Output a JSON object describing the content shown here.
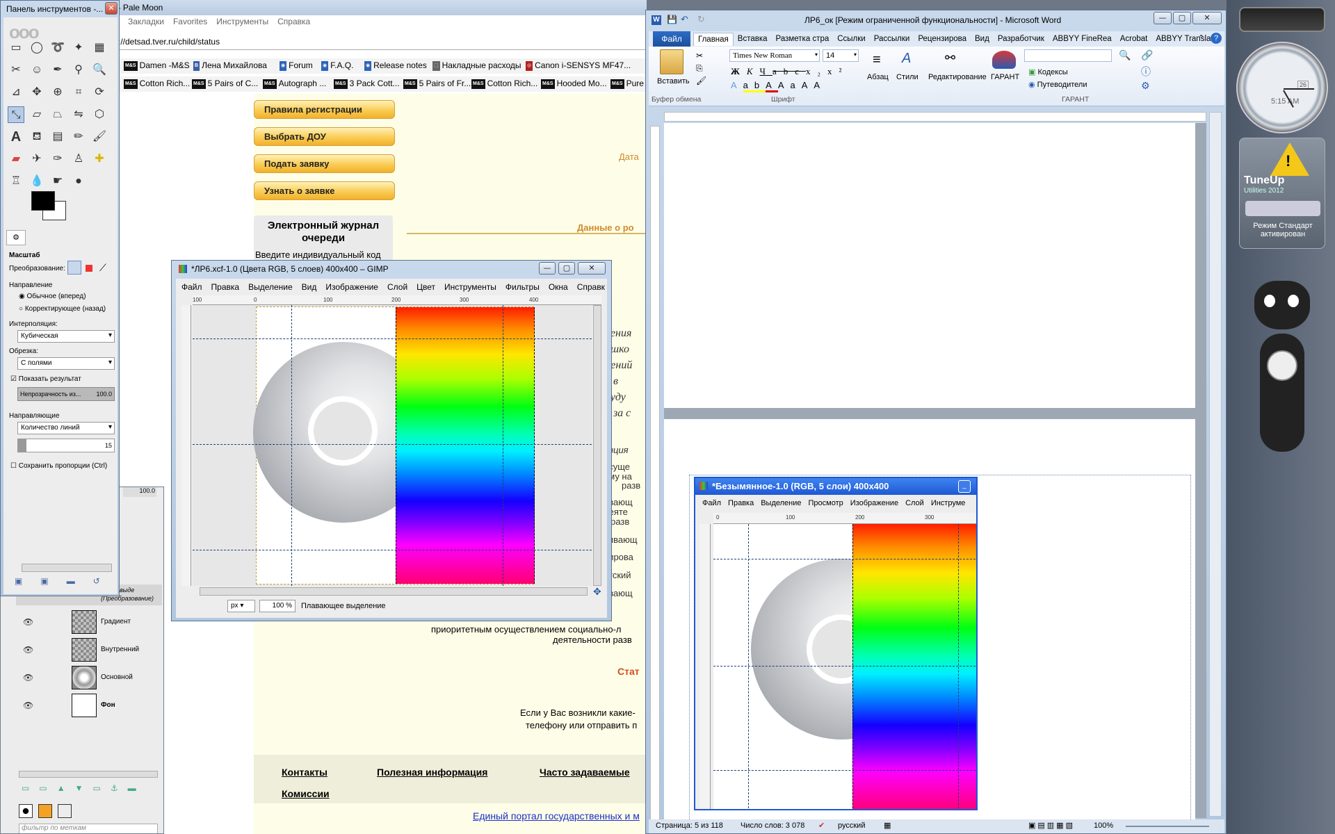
{
  "browser": {
    "title": "ь - Pale Moon",
    "menu": [
      "Закладки",
      "Favorites",
      "Инструменты",
      "Справка"
    ],
    "url": "://detsad.tver.ru/child/status",
    "bm1": [
      {
        "t": "Damen -M&S",
        "b": "M&S"
      },
      {
        "t": "Лена Михайлова",
        "b": "B"
      },
      {
        "t": "Forum",
        "b": "◉"
      },
      {
        "t": "F.A.Q.",
        "b": "◉"
      },
      {
        "t": "Release notes",
        "b": "◉"
      },
      {
        "t": "Накладные расходы",
        "b": "⬚"
      },
      {
        "t": "Canon i-SENSYS MF47...",
        "b": "◎"
      }
    ],
    "bm2": [
      "Cotton Rich...",
      "5 Pairs of C...",
      "Autograph ...",
      "3 Pack Cott...",
      "5 Pairs of Fr...",
      "Cotton Rich...",
      "Hooded Mo...",
      "Pure"
    ],
    "bm_badge": "M&S"
  },
  "site": {
    "buttons": [
      "Правила регистрации",
      "Выбрать ДОУ",
      "Подать заявку",
      "Узнать о заявке"
    ],
    "journal_title": "Электронный журнал очереди",
    "journal_text": "Введите индивидуальный код",
    "date": "Дата",
    "parents": "Данные о ро",
    "frag": [
      "нения",
      "ошко",
      "дений",
      "а в",
      "буду",
      "н за с",
      "виция",
      "осуще",
      "ому на",
      "разв",
      "ивающ",
      "деяте",
      "у разв",
      "вивающ",
      "нирова",
      "ятский",
      "ивающ"
    ],
    "line_a": "приоритетным осуществлением социально-л",
    "line_b": "деятельности разв",
    "status": "Стат",
    "help_a": "Если у Вас возникли какие-",
    "help_b": "телефону или отправить п",
    "footer": [
      "Контакты",
      "Полезная информация",
      "Часто задаваемые",
      "Комиссии"
    ],
    "portal": "Единый портал государственных и м"
  },
  "toolbox": {
    "title": "Панель инструментов -...",
    "section": "Масштаб",
    "transform": "Преобразование:",
    "direction": "Направление",
    "dir_fwd": "Обычное (вперед)",
    "dir_back": "Корректирующее (назад)",
    "interp_l": "Интерполяция:",
    "interp": "Кубическая",
    "clip_l": "Обрезка:",
    "clip": "С полями",
    "show": "Показать результат",
    "opacity": "Непрозрачность из...",
    "opacity_v": "100.0",
    "guides_l": "Направляющие",
    "guides": "Количество линий",
    "lines_v": "15",
    "keep": "Сохранить пропорции  (Ctrl)"
  },
  "layers": {
    "value": "100.0",
    "items": [
      "Градиент",
      "Внутренний",
      "Основной",
      "Фон"
    ],
    "partial": "ющее выде",
    "partial2": "(Преобразование)",
    "filter": "фильтр по меткам"
  },
  "gimp1": {
    "title": "*ЛР6.xcf-1.0 (Цвета RGB, 5 слоев) 400x400 – GIMP",
    "menu": [
      "Файл",
      "Правка",
      "Выделение",
      "Вид",
      "Изображение",
      "Слой",
      "Цвет",
      "Инструменты",
      "Фильтры",
      "Окна",
      "Справк"
    ],
    "ticks": [
      "100",
      "0",
      "100",
      "200",
      "300",
      "400"
    ],
    "unit": "px",
    "zoom": "100 %",
    "status": "Плавающее выделение"
  },
  "word": {
    "title": "ЛР6_ок [Режим ограниченной функциональности]  -  Microsoft Word",
    "file": "Файл",
    "tabs": [
      "Главная",
      "Вставка",
      "Разметка стра",
      "Ссылки",
      "Рассылки",
      "Рецензирова",
      "Вид",
      "Разработчик",
      "ABBYY FineRea",
      "Acrobat",
      "ABBYY Translat"
    ],
    "paste": "Вставить",
    "clipboard": "Буфер обмена",
    "font": "Times New Roman",
    "size": "14",
    "font_g": "Шрифт",
    "para": "Абзац",
    "styles": "Стили",
    "editing": "Редактирование",
    "garant": "ГАРАНТ",
    "codex": "Кодексы",
    "guides": "Путеводители",
    "garant_g": "ГАРАНТ",
    "status_page": "Страница: 5 из 118",
    "status_words": "Число слов: 3 078",
    "lang": "русский",
    "zoom": "100%"
  },
  "gimp2": {
    "title": "*Безымянное-1.0 (RGB, 5 слои) 400x400",
    "menu": [
      "Файл",
      "Правка",
      "Выделение",
      "Просмотр",
      "Изображение",
      "Слой",
      "Инструме"
    ],
    "ticks": [
      "0",
      "100",
      "200",
      "300"
    ]
  },
  "gadgets": {
    "clock_time": "5:15 AM",
    "clock_date": "26",
    "tuneup": "TuneUp",
    "tuneup_sub": "Utilities 2012",
    "mode": "Режим Стандарт активирован"
  }
}
